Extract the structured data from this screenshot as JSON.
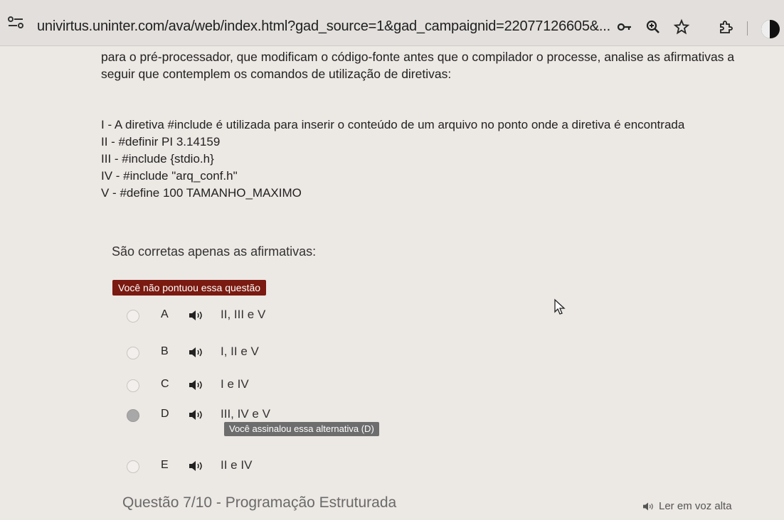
{
  "browser": {
    "url": "univirtus.uninter.com/ava/web/index.html?gad_source=1&gad_campaignid=22077126605&..."
  },
  "question": {
    "intro": "para o pré-processador, que modificam o código-fonte antes que o compilador o processe, analise as afirmativas a seguir que contemplem os comandos de utilização de diretivas:",
    "statements": [
      "I   - A diretiva #include é utilizada para inserir o conteúdo de um arquivo no ponto onde a diretiva é encontrada",
      "II  - #definir PI 3.14159",
      "III - #include {stdio.h}",
      "IV - #include \"arq_conf.h\"",
      "V  - #define 100 TAMANHO_MAXIMO"
    ],
    "prompt": "São corretas apenas as afirmativas:",
    "score_badge": "Você não pontuou essa questão",
    "options": [
      {
        "letter": "A",
        "text": "II, III e V",
        "selected": false
      },
      {
        "letter": "B",
        "text": "I, II e V",
        "selected": false
      },
      {
        "letter": "C",
        "text": "I e IV",
        "selected": false
      },
      {
        "letter": "D",
        "text": "III, IV e V",
        "selected": true
      },
      {
        "letter": "E",
        "text": "II e IV",
        "selected": false
      }
    ],
    "selected_badge": "Você assinalou essa alternativa (D)"
  },
  "footer": {
    "title": "Questão 7/10 - Programação Estruturada",
    "read_aloud": "Ler em voz alta"
  },
  "colors": {
    "score_badge_bg": "#7a1a10",
    "selected_badge_bg": "#6d6d6d"
  },
  "icons": [
    "site-info-icon",
    "password-key-icon",
    "zoom-icon",
    "star-icon",
    "extensions-icon",
    "speaker-icon"
  ]
}
